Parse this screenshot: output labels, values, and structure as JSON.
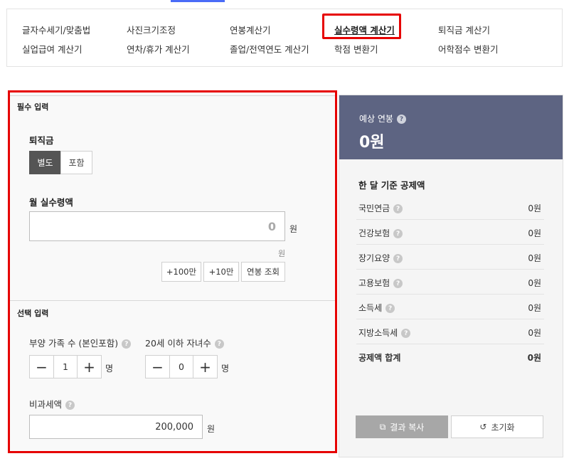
{
  "nav": {
    "items": [
      {
        "label": "글자수세기/맞춤법"
      },
      {
        "label": "사진크기조정"
      },
      {
        "label": "연봉계산기"
      },
      {
        "label": "실수령액 계산기"
      },
      {
        "label": "퇴직금 계산기"
      },
      {
        "label": "실업급여 계산기"
      },
      {
        "label": "연차/휴가 계산기"
      },
      {
        "label": "졸업/전역연도 계산기"
      },
      {
        "label": "학점 변환기"
      },
      {
        "label": "어학점수 변환기"
      }
    ]
  },
  "required": {
    "section_title": "필수 입력",
    "severance_label": "퇴직금",
    "severance_options": [
      "별도",
      "포함"
    ],
    "monthly_label": "월 실수령액",
    "monthly_value": "0",
    "unit": "원",
    "unit_hint": "원",
    "quick_buttons": [
      "+100만",
      "+10만",
      "연봉 조회"
    ]
  },
  "optional": {
    "section_title": "선택 입력",
    "dependents_label": "부양 가족 수 (본인포함)",
    "dependents_value": "1",
    "children_label": "20세 이하 자녀수",
    "children_value": "0",
    "count_unit": "명",
    "nontax_label": "비과세액",
    "nontax_value": "200,000",
    "unit": "원"
  },
  "result": {
    "salary_label": "예상 연봉",
    "salary_value": "0원",
    "deduct_title": "한 달 기준 공제액",
    "rows": [
      {
        "name": "국민연금",
        "value": "0원"
      },
      {
        "name": "건강보험",
        "value": "0원"
      },
      {
        "name": "장기요양",
        "value": "0원"
      },
      {
        "name": "고용보험",
        "value": "0원"
      },
      {
        "name": "소득세",
        "value": "0원"
      },
      {
        "name": "지방소득세",
        "value": "0원"
      }
    ],
    "total_name": "공제액 합계",
    "total_value": "0원",
    "copy_label": "결과 복사",
    "reset_label": "초기화"
  },
  "colors": {
    "highlight": "#e60000",
    "result_header": "#5d6482",
    "toggle_active": "#555555"
  }
}
